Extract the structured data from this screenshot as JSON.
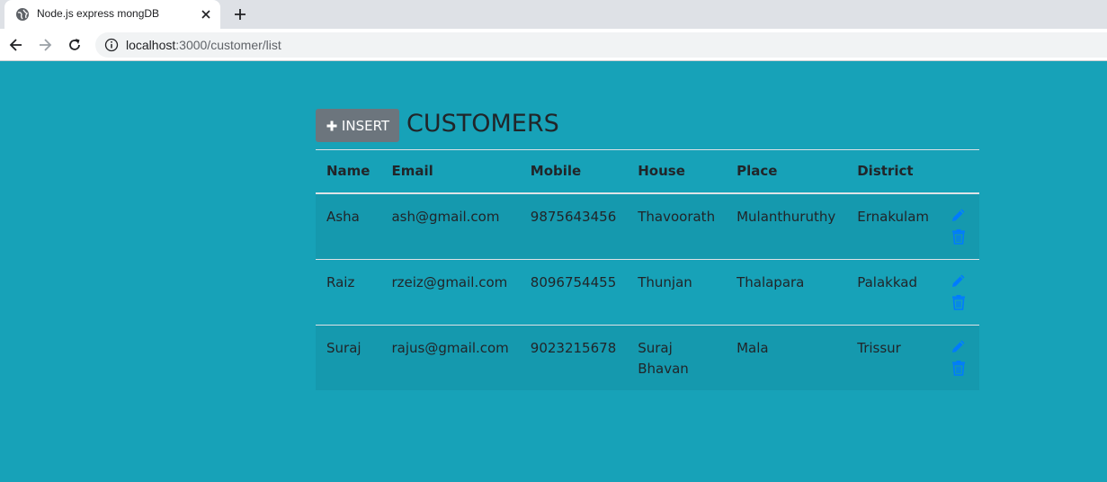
{
  "browser": {
    "tab_title": "Node.js express mongDB",
    "url_host": "localhost",
    "url_path": ":3000/customer/list"
  },
  "page": {
    "insert_label": "INSERT",
    "title": "CUSTOMERS"
  },
  "table": {
    "headers": [
      "Name",
      "Email",
      "Mobile",
      "House",
      "Place",
      "District"
    ],
    "rows": [
      [
        "Asha",
        "ash@gmail.com",
        "9875643456",
        "Thavoorath",
        "Mulanthuruthy",
        "Ernakulam"
      ],
      [
        "Raiz",
        "rzeiz@gmail.com",
        "8096754455",
        "Thunjan",
        "Thalapara",
        "Palakkad"
      ],
      [
        "Suraj",
        "rajus@gmail.com",
        "9023215678",
        "Suraj Bhavan",
        "Mala",
        "Trissur"
      ]
    ]
  },
  "colors": {
    "page_bg": "#17a2b8",
    "action_icon": "#007bff",
    "insert_button": "#6c757d"
  },
  "icons": {
    "edit": "pencil-icon",
    "delete": "trash-icon",
    "insert": "plus-icon"
  }
}
